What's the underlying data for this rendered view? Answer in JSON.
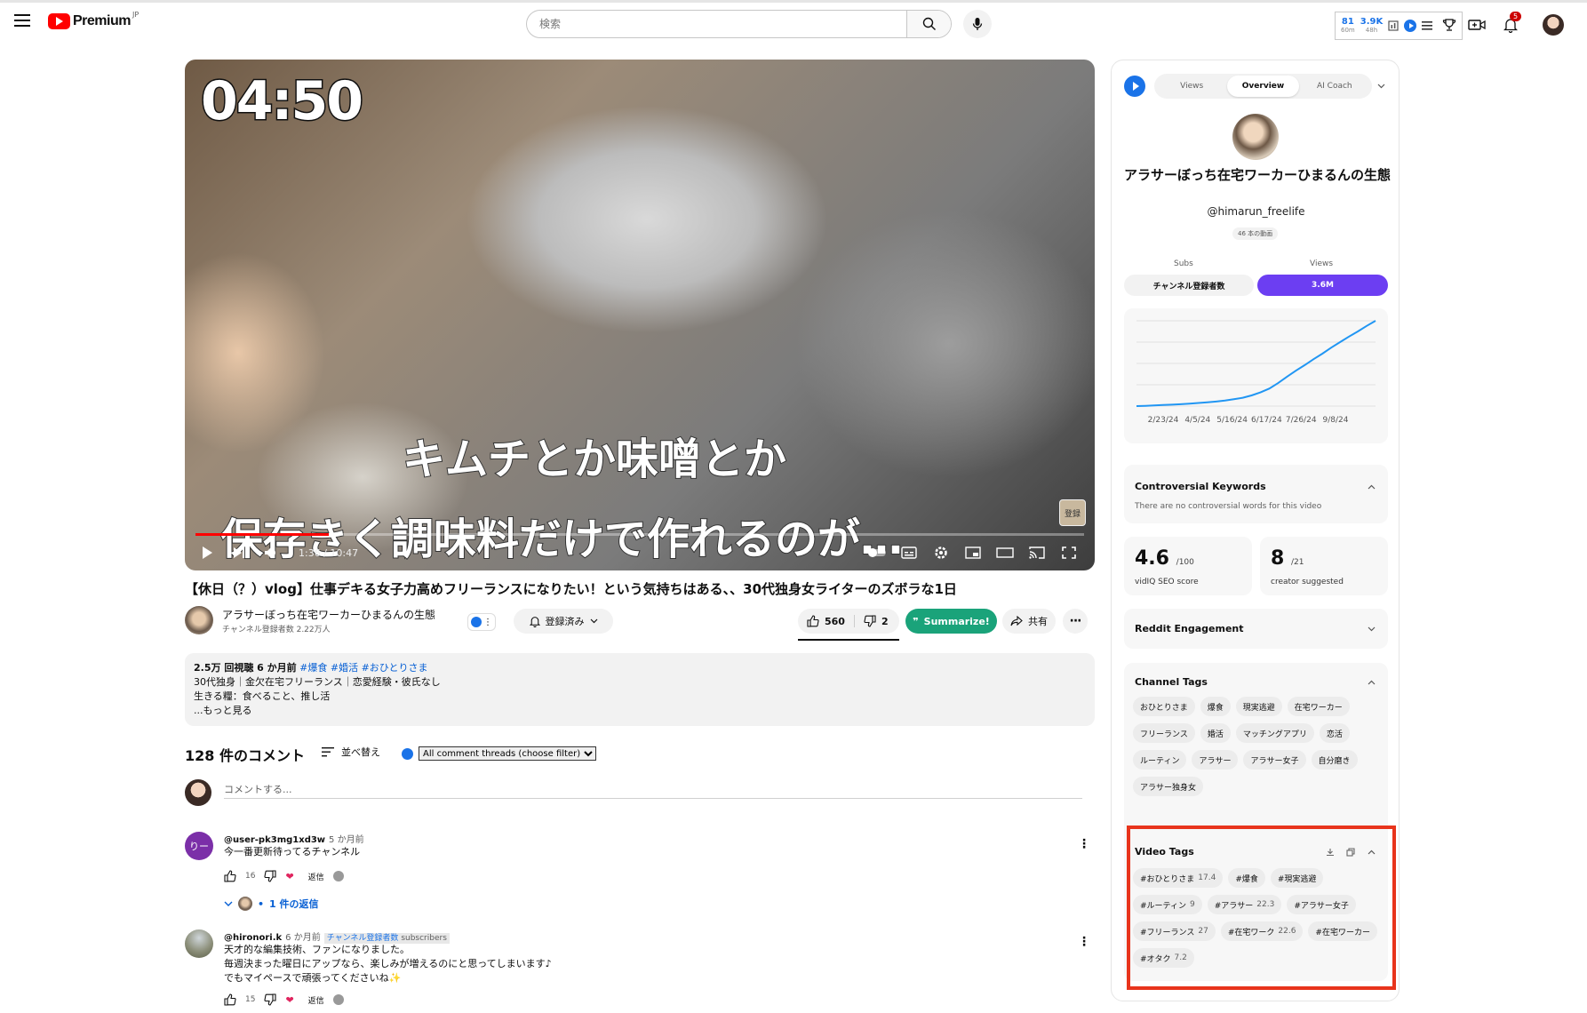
{
  "header": {
    "logo_text": "Premium",
    "logo_region": "JP",
    "search_placeholder": "検索",
    "ext_stats": [
      {
        "value": "81",
        "label": "60m"
      },
      {
        "value": "3.9K",
        "label": "48h"
      }
    ],
    "notification_count": "5"
  },
  "video": {
    "overlay_timer": "04:50",
    "subtitle_line1": "キムチとか味噌とか",
    "subtitle_line2": "保存きく調味料だけで作れるのが…",
    "watermark": "登録",
    "time": "1:36 / 10:47",
    "progress_fraction": 0.15
  },
  "title": "【休日（？）vlog】仕事デキる女子力高めフリーランスになりたい！という気持ちはある、、30代独身女ライターのズボラな1日",
  "channel": {
    "name": "アラサーぼっち在宅ワーカーひまるんの生態",
    "subs": "チャンネル登録者数 2.22万人",
    "subscribed_label": "登録済み",
    "likes": "560",
    "dislikes": "2",
    "summarize_label": "Summarize!",
    "share_label": "共有"
  },
  "description": {
    "meta": "2.5万 回視聴  6 か月前",
    "tags": "#爆食 #婚活 #おひとりさま",
    "line1": "30代独身｜金欠在宅フリーランス｜恋愛経験・彼氏なし",
    "line2": "生きる糧：食べること、推し活",
    "more": "...もっと見る"
  },
  "comments": {
    "count_label": "128 件のコメント",
    "sort_label": "並べ替え",
    "filter_option": "All comment threads (choose filter)",
    "add_placeholder": "コメントする...",
    "items": [
      {
        "avatar_text": "りー",
        "user": "@user-pk3mg1xd3w",
        "time": "5 か月前",
        "lines": [
          "今一番更新待ってるチャンネル"
        ],
        "likes": "16",
        "reply_label": "返信",
        "replies_label": "1 件の返信"
      },
      {
        "user": "@hironori.k",
        "time": "6 か月前",
        "chip": "チャンネル登録者数",
        "chip_sub": "subscribers",
        "lines": [
          "天才的な編集技術、ファンになりました。",
          "毎週決まった曜日にアップなら、楽しみが増えるのにと思ってしまいます♪",
          "でもマイペースで頑張ってくださいね✨"
        ],
        "likes": "15",
        "reply_label": "返信"
      }
    ]
  },
  "panel": {
    "tabs": [
      "Views",
      "Overview",
      "AI Coach"
    ],
    "active_tab": "Overview",
    "channel_name": "アラサーぼっち在宅ワーカーひまるんの生態",
    "handle": "@himarun_freelife",
    "video_count": "46 本の動画",
    "subs_label": "Subs",
    "views_label": "Views",
    "subs_value": "チャンネル登録者数",
    "views_value": "3.6M",
    "controversial_title": "Controversial Keywords",
    "controversial_text": "There are no controversial words for this video",
    "seo_score": "4.6",
    "seo_max": "/100",
    "seo_label": "vidIQ SEO score",
    "creator_count": "8",
    "creator_max": "/21",
    "creator_label": "creator suggested",
    "reddit_title": "Reddit Engagement",
    "channel_tags_title": "Channel Tags",
    "channel_tags": [
      "おひとりさま",
      "爆食",
      "現実逃避",
      "在宅ワーカー",
      "フリーランス",
      "婚活",
      "マッチングアプリ",
      "恋活",
      "ルーティン",
      "アラサー",
      "アラサー女子",
      "自分磨き",
      "アラサー独身女"
    ],
    "video_tags_title": "Video Tags",
    "video_tags": [
      {
        "tag": "#おひとりさま",
        "score": "17.4"
      },
      {
        "tag": "#爆食",
        "score": ""
      },
      {
        "tag": "#現実逃避",
        "score": ""
      },
      {
        "tag": "#ルーティン",
        "score": "9"
      },
      {
        "tag": "#アラサー",
        "score": "22.3"
      },
      {
        "tag": "#アラサー女子",
        "score": ""
      },
      {
        "tag": "#フリーランス",
        "score": "27"
      },
      {
        "tag": "#在宅ワーク",
        "score": "22.6"
      },
      {
        "tag": "#在宅ワーカー",
        "score": ""
      },
      {
        "tag": "#オタク",
        "score": "7.2"
      }
    ]
  },
  "chart_data": {
    "type": "line",
    "x_ticks": [
      "2/23/24",
      "4/5/24",
      "5/16/24",
      "6/17/24",
      "7/26/24",
      "9/8/24"
    ],
    "series": [
      {
        "values": [
          0.0,
          0.3,
          0.7,
          1.2,
          1.7,
          2.2,
          2.9,
          3.6,
          4.4,
          5.3,
          6.5,
          8.0,
          9.8,
          12.5,
          16.0,
          20.5,
          27.0,
          34.5,
          41.5,
          48.0,
          55.0,
          61.5,
          68.5,
          75.0,
          81.5,
          87.5,
          94.0,
          100.0
        ]
      }
    ],
    "grid": true,
    "color": "#2196f3"
  },
  "colors": {
    "accent": "#1a73e8",
    "summarize": "#1aa37a",
    "views_toggle": "#6c3ef2",
    "highlight": "#e8341c"
  }
}
